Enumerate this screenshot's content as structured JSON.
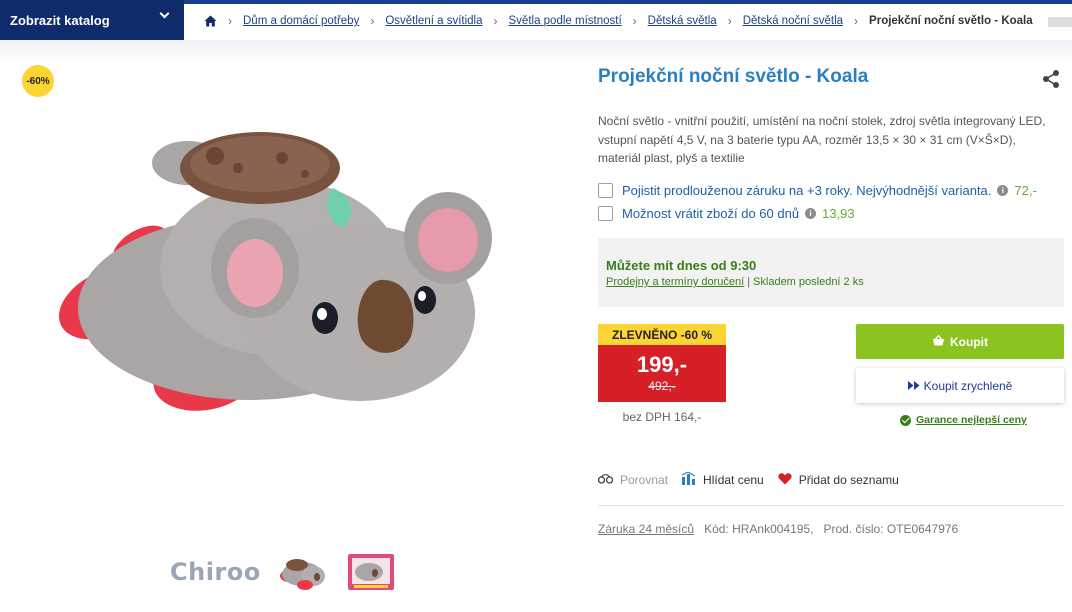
{
  "header": {
    "catalog_label": "Zobrazit katalog",
    "breadcrumbs": [
      {
        "label": "Dům a domácí potřeby"
      },
      {
        "label": "Osvětlení a svítidla"
      },
      {
        "label": "Světla podle místností"
      },
      {
        "label": "Dětská světla"
      },
      {
        "label": "Dětská noční světla"
      }
    ],
    "current": "Projekční noční světlo - Koala"
  },
  "gallery": {
    "discount_badge": "-60%",
    "brand": "Chiroo",
    "main_image_icon": "koala-plush-night-light-image"
  },
  "product": {
    "title": "Projekční noční světlo - Koala",
    "description": "Noční světlo - vnitřní použití, umístění na noční stolek, zdroj světla integrovaný LED, vstupní napětí 4,5 V, na 3 baterie typu AA, rozměr 13,5 × 30 × 31 cm (V×Š×D), materiál plast, plyš a textilie"
  },
  "options": [
    {
      "label": "Pojistit prodlouženou záruku na +3 roky. Nejvýhodnější varianta.",
      "price": "72,-"
    },
    {
      "label": "Možnost vrátit zboží do 60 dnů",
      "price": "13,93"
    }
  ],
  "availability": {
    "headline": "Můžete mít dnes od 9:30",
    "link": "Prodejny a termíny doručení",
    "stock": "Skladem poslední 2 ks"
  },
  "pricing": {
    "sale_label": "ZLEVNĚNO -60 %",
    "price": "199,-",
    "old_price": "492,-",
    "without_vat": "bez DPH 164,-"
  },
  "buttons": {
    "buy": "Koupit",
    "quick_buy": "Koupit zrychleně",
    "guarantee": "Garance nejlepší ceny"
  },
  "actions": {
    "compare": "Porovnat",
    "watch_price": "Hlídat cenu",
    "wishlist": "Přidat do seznamu"
  },
  "meta": {
    "warranty": "Záruka 24 měsíců",
    "code": "Kód: HRAnk004195,",
    "product_number": "Prod. číslo: OTE0647976"
  },
  "colors": {
    "brand_navy": "#0f2b6b",
    "title_blue": "#2a7fc1",
    "buy_green": "#8cc41f",
    "price_red": "#d61f26",
    "sale_yellow": "#fcd535"
  }
}
